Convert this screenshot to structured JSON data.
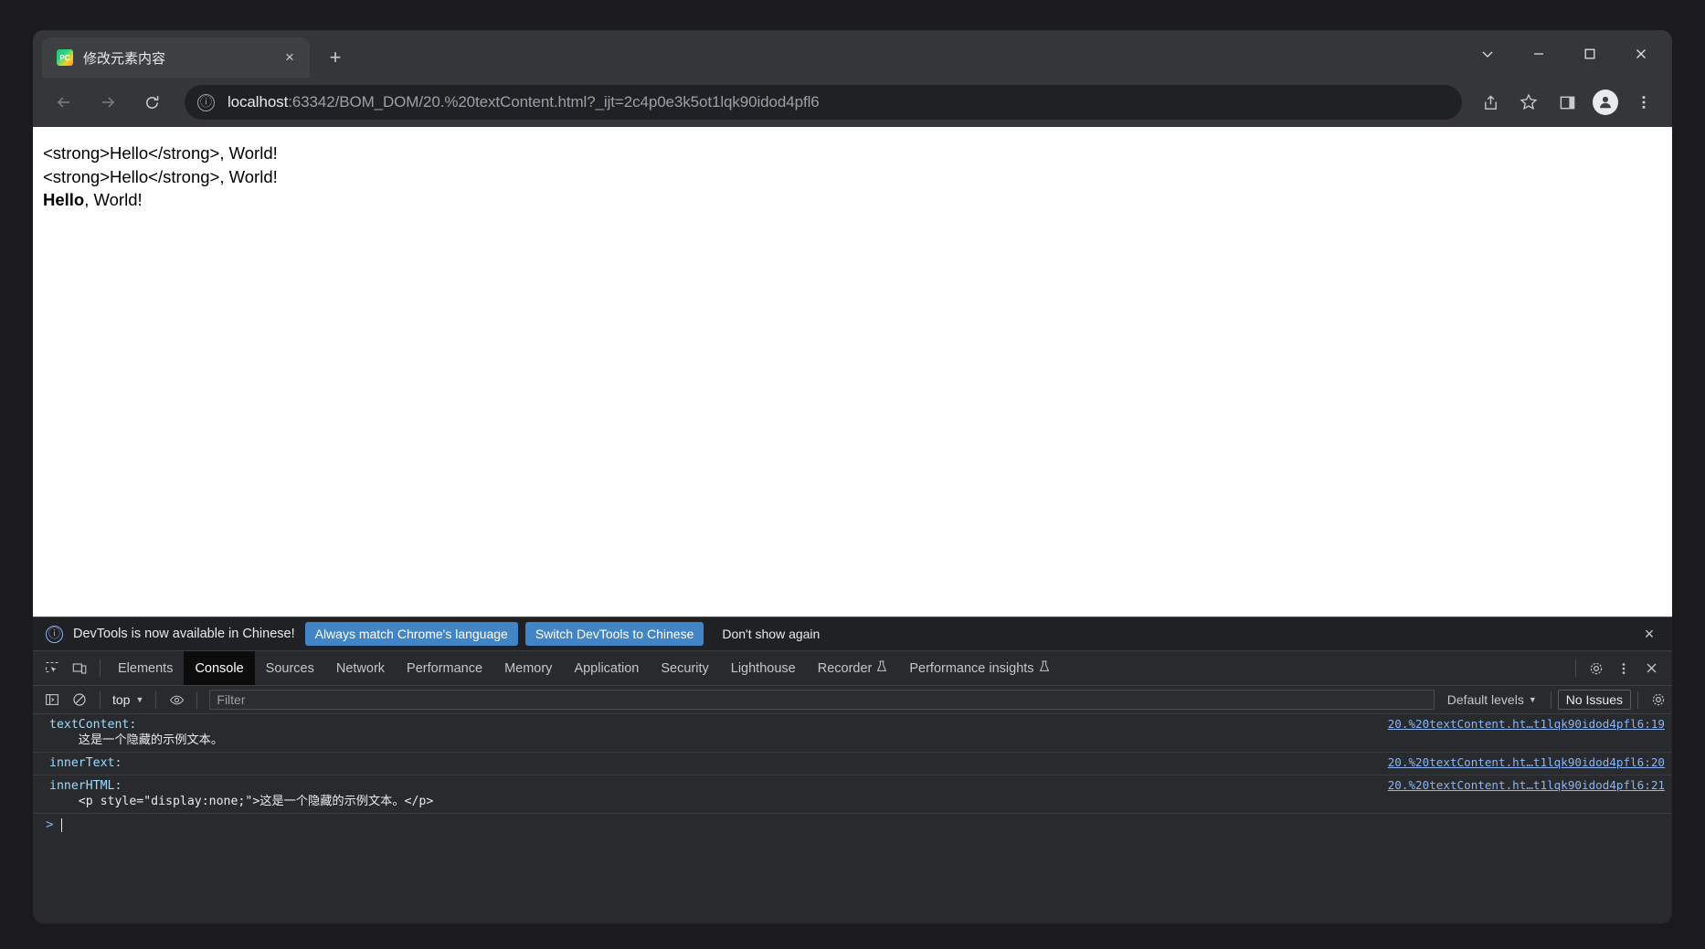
{
  "browser": {
    "tab": {
      "title": "修改元素内容",
      "favicon": "pycharm-icon",
      "close_label": "×"
    },
    "new_tab_label": "+",
    "window_controls": {
      "minimize_all": "chevron-down-icon",
      "minimize": "minimize-icon",
      "maximize": "maximize-icon",
      "close": "close-icon"
    },
    "nav": {
      "back": "back-arrow-icon",
      "forward": "forward-arrow-icon",
      "reload": "reload-icon"
    },
    "omnibox": {
      "info_icon": "ⓘ",
      "host": "localhost",
      "rest": ":63342/BOM_DOM/20.%20textContent.html?_ijt=2c4p0e3k5ot1lqk90idod4pfl6",
      "full_url": "localhost:63342/BOM_DOM/20.%20textContent.html?_ijt=2c4p0e3k5ot1lqk90idod4pfl6"
    },
    "toolbar_icons": [
      "share-icon",
      "bookmark-star-icon",
      "side-panel-icon",
      "profile-avatar-icon",
      "more-menu-icon"
    ]
  },
  "page": {
    "lines": [
      "<strong>Hello</strong>, World!",
      "<strong>Hello</strong>, World!"
    ],
    "rendered_line": {
      "bold": "Hello",
      "rest": ", World!"
    }
  },
  "devtools": {
    "banner": {
      "info_icon": "ⓘ",
      "text": "DevTools is now available in Chinese!",
      "primary_buttons": [
        "Always match Chrome's language",
        "Switch DevTools to Chinese"
      ],
      "dismiss": "Don't show again",
      "close": "×",
      "accent": "#4285c4"
    },
    "tools": {
      "inspect": "inspect-element-icon",
      "device": "device-toolbar-icon"
    },
    "tabs": [
      {
        "label": "Elements",
        "active": false,
        "experimental": false
      },
      {
        "label": "Console",
        "active": true,
        "experimental": false
      },
      {
        "label": "Sources",
        "active": false,
        "experimental": false
      },
      {
        "label": "Network",
        "active": false,
        "experimental": false
      },
      {
        "label": "Performance",
        "active": false,
        "experimental": false
      },
      {
        "label": "Memory",
        "active": false,
        "experimental": false
      },
      {
        "label": "Application",
        "active": false,
        "experimental": false
      },
      {
        "label": "Security",
        "active": false,
        "experimental": false
      },
      {
        "label": "Lighthouse",
        "active": false,
        "experimental": false
      },
      {
        "label": "Recorder",
        "active": false,
        "experimental": true
      },
      {
        "label": "Performance insights",
        "active": false,
        "experimental": true
      }
    ],
    "tabs_right": {
      "settings": "gear-icon",
      "more": "more-vertical-icon",
      "close": "close-icon"
    },
    "filterbar": {
      "sidebar_toggle": "console-sidebar-icon",
      "clear": "clear-console-icon",
      "context": "top",
      "eye": "live-expression-icon",
      "filter_placeholder": "Filter",
      "filter_value": "",
      "levels": "Default levels",
      "issues": "No Issues",
      "settings": "gear-icon"
    },
    "console": {
      "rows": [
        {
          "label": "textContent:",
          "body": "    这是一个隐藏的示例文本。",
          "source": "20.%20textContent.ht…t1lqk90idod4pfl6:19"
        },
        {
          "label": "innerText:",
          "body": "",
          "source": "20.%20textContent.ht…t1lqk90idod4pfl6:20"
        },
        {
          "label": "innerHTML:",
          "body": "    <p style=\"display:none;\">这是一个隐藏的示例文本。</p>",
          "source": "20.%20textContent.ht…t1lqk90idod4pfl6:21"
        }
      ],
      "prompt": ">"
    }
  }
}
